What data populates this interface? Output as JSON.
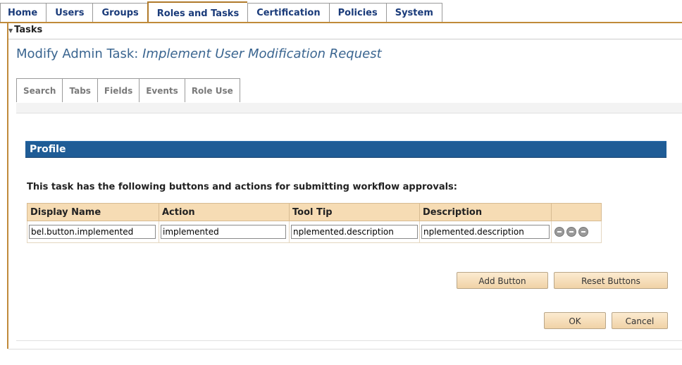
{
  "top_tabs": [
    {
      "label": "Home"
    },
    {
      "label": "Users"
    },
    {
      "label": "Groups"
    },
    {
      "label": "Roles and Tasks"
    },
    {
      "label": "Certification"
    },
    {
      "label": "Policies"
    },
    {
      "label": "System"
    }
  ],
  "active_top_tab": "Roles and Tasks",
  "section_label": "Tasks",
  "title_prefix": "Modify Admin Task:",
  "title_task_name": "Implement User Modification Request",
  "sub_tabs": [
    {
      "label": "Search"
    },
    {
      "label": "Tabs"
    },
    {
      "label": "Fields"
    },
    {
      "label": "Events"
    },
    {
      "label": "Role Use"
    }
  ],
  "profile_header": "Profile",
  "description": "This task has the following buttons and actions for submitting workflow approvals:",
  "table": {
    "headers": [
      "Display Name",
      "Action",
      "Tool Tip",
      "Description"
    ],
    "rows": [
      {
        "display_name": "bel.button.implemented",
        "action": "implemented",
        "tool_tip": "nplemented.description",
        "description": "nplemented.description"
      }
    ],
    "row_icons": [
      "remove-icon",
      "remove-icon",
      "remove-icon"
    ]
  },
  "buttons": {
    "add": "Add Button",
    "reset": "Reset Buttons",
    "ok": "OK",
    "cancel": "Cancel"
  },
  "colors": {
    "tab_accent": "#c08a3a",
    "title": "#3a6590",
    "profile_bar": "#1f5c96",
    "table_header": "#f6dcb4"
  }
}
